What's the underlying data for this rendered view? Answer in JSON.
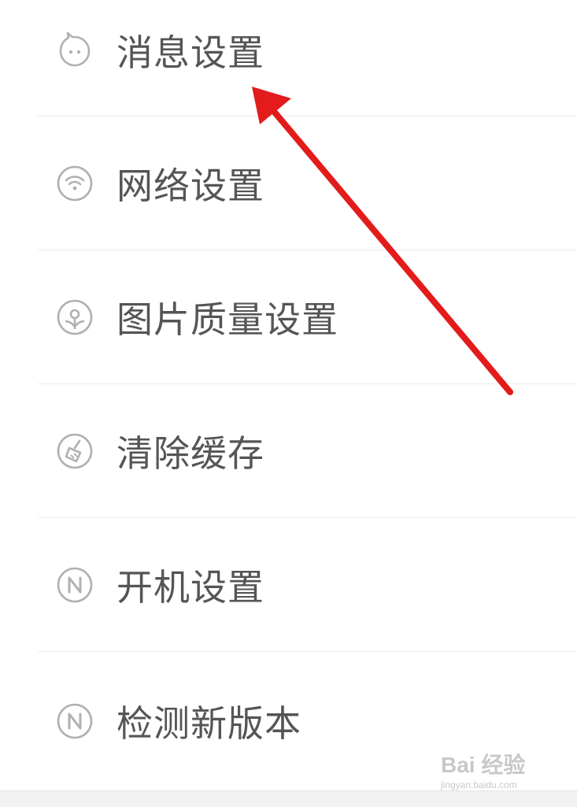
{
  "settings": {
    "items": [
      {
        "label": "消息设置",
        "icon": "message-face-icon"
      },
      {
        "label": "网络设置",
        "icon": "wifi-icon"
      },
      {
        "label": "图片质量设置",
        "icon": "image-quality-icon"
      },
      {
        "label": "清除缓存",
        "icon": "broom-icon"
      },
      {
        "label": "开机设置",
        "icon": "startup-n-icon"
      },
      {
        "label": "检测新版本",
        "icon": "version-n-icon"
      }
    ]
  },
  "annotation": {
    "arrow_color": "#e31b1b"
  },
  "watermark": {
    "main": "Bai 经验",
    "sub": "jingyan.baidu.com"
  },
  "colors": {
    "text": "#555555",
    "icon": "#b0b0b0",
    "divider": "#ececec"
  }
}
